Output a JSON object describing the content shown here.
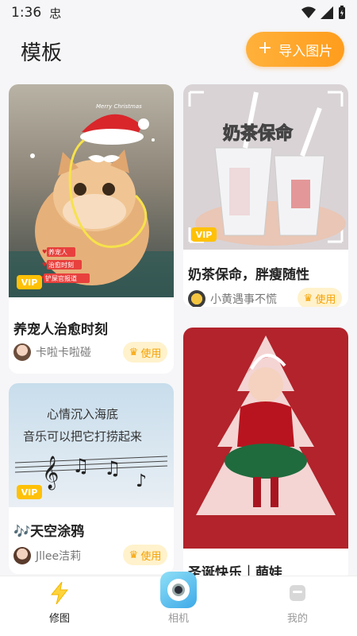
{
  "statusbar": {
    "time": "1:36",
    "sim_glyph": "忠"
  },
  "header": {
    "title": "模板",
    "import_label": "导入图片"
  },
  "cards": [
    {
      "title": "养宠人治愈时刻",
      "author": "卡啦卡啦碰",
      "use_label": "使用",
      "vip_label": "VIP",
      "image_text": [
        "Merry Christmas",
        "养宠人",
        "治愈时刻",
        "铲屎官报道"
      ]
    },
    {
      "title": "奶茶保命，胖瘦随性",
      "author": "小黄遇事不慌",
      "use_label": "使用",
      "vip_label": "VIP",
      "image_text": [
        "奶茶保命"
      ]
    },
    {
      "title": "🎶天空涂鸦",
      "author": "Jllee洁莉",
      "use_label": "使用",
      "vip_label": "VIP",
      "image_text": [
        "心情沉入海底",
        "音乐可以把它打捞起来"
      ]
    },
    {
      "title": "圣诞快乐｜萌娃"
    }
  ],
  "bottomnav": {
    "items": [
      {
        "label": "修图",
        "active": true
      },
      {
        "label": "相机",
        "active": false
      },
      {
        "label": "我的",
        "active": false
      }
    ]
  },
  "colors": {
    "accent": "#ff9d1d",
    "use_bg": "#fff2cc",
    "vip": "#ffc107"
  }
}
